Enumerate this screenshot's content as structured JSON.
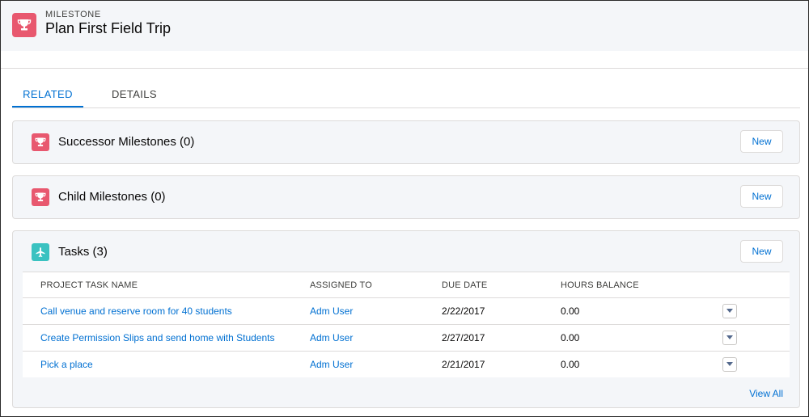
{
  "header": {
    "eyebrow": "MILESTONE",
    "title": "Plan First Field Trip",
    "icon": "trophy-icon",
    "icon_color": "#e8586f"
  },
  "tabs": [
    {
      "label": "RELATED",
      "active": true
    },
    {
      "label": "DETAILS",
      "active": false
    }
  ],
  "cards": {
    "successor": {
      "title": "Successor Milestones (0)",
      "button": "New",
      "icon": "trophy-icon"
    },
    "child": {
      "title": "Child Milestones (0)",
      "button": "New",
      "icon": "trophy-icon"
    },
    "tasks": {
      "title": "Tasks (3)",
      "button": "New",
      "icon": "plane-icon",
      "icon_color": "#3ac2c1"
    }
  },
  "tasks_table": {
    "columns": [
      "PROJECT TASK NAME",
      "ASSIGNED TO",
      "DUE DATE",
      "HOURS BALANCE"
    ],
    "rows": [
      {
        "name": "Call venue and reserve room for 40 students",
        "assigned": "Adm User",
        "due": "2/22/2017",
        "hours": "0.00"
      },
      {
        "name": "Create Permission Slips and send home with Students",
        "assigned": "Adm User",
        "due": "2/27/2017",
        "hours": "0.00"
      },
      {
        "name": "Pick a place",
        "assigned": "Adm User",
        "due": "2/21/2017",
        "hours": "0.00"
      }
    ],
    "view_all": "View All"
  },
  "colors": {
    "accent": "#0070d2",
    "milestone": "#e8586f",
    "task": "#3ac2c1"
  }
}
